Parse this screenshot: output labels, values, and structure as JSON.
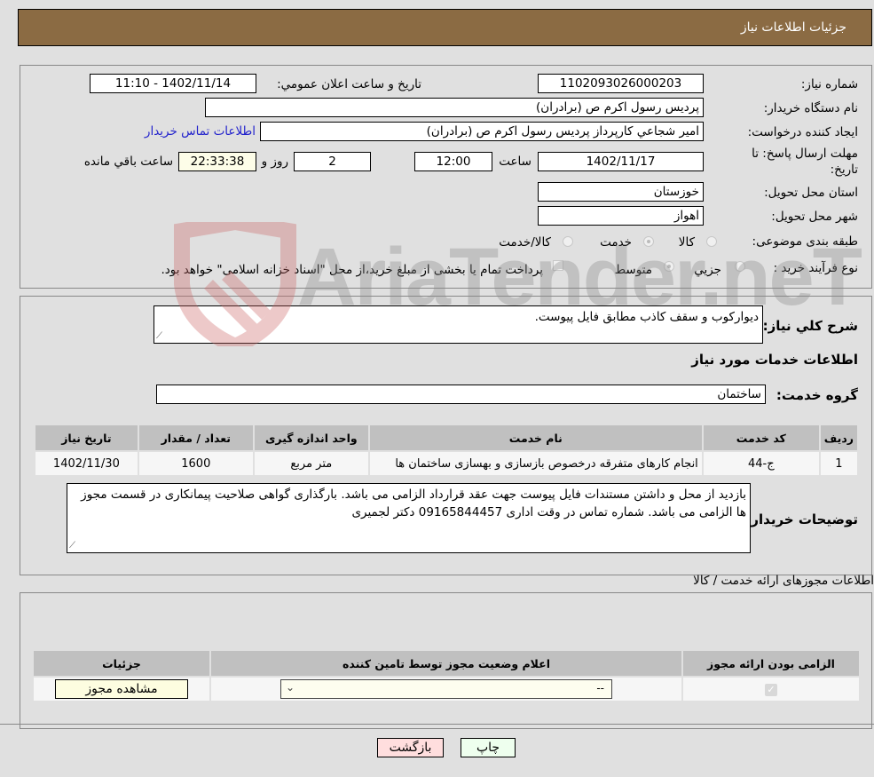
{
  "header": {
    "title": "جزئيات اطلاعات نياز"
  },
  "form": {
    "need_number": {
      "label": "شماره نياز:",
      "value": "1102093026000203"
    },
    "announce_datetime": {
      "label": "تاريخ و ساعت اعلان عمومي:",
      "value": "1402/11/14 - 11:10"
    },
    "buyer_org": {
      "label": "نام دستگاه خريدار:",
      "value": "پرديس رسول اكرم ص (برادران)"
    },
    "requester": {
      "label": "ايجاد كننده درخواست:",
      "value": "امير  شجاعي كارپرداز پرديس رسول اكرم ص (برادران)"
    },
    "buyer_contact_link": "اطلاعات تماس خريدار",
    "deadline": {
      "label_line1": "مهلت ارسال پاسخ: تا",
      "label_line2": "تاريخ:",
      "date": "1402/11/17",
      "time_label": "ساعت",
      "time": "12:00",
      "days": "2",
      "days_label": "روز و",
      "remaining": "22:33:38",
      "remaining_label": "ساعت باقي مانده"
    },
    "province": {
      "label": "استان محل تحويل:",
      "value": "خوزستان"
    },
    "city": {
      "label": "شهر محل تحويل:",
      "value": "اهواز"
    },
    "category": {
      "label": "طبقه بندی موضوعی:",
      "options": [
        "كالا",
        "خدمت",
        "كالا/خدمت"
      ],
      "selected": "خدمت"
    },
    "process_type": {
      "label": "نوع فرآيند خريد :",
      "options": [
        "جزيي",
        "متوسط"
      ],
      "selected": "متوسط",
      "treasury_note": "پرداخت تمام يا بخشی از مبلغ خريد،از محل \"اسناد خزانه اسلامی\" خواهد بود."
    }
  },
  "description": {
    "label": "شرح كلي نياز:",
    "value": "ديواركوب و سقف كاذب مطابق فايل پيوست."
  },
  "services": {
    "section_title": "اطلاعات خدمات مورد نياز",
    "group_label": "گروه خدمت:",
    "group_value": "ساختمان",
    "table": {
      "headers": [
        "رديف",
        "كد خدمت",
        "نام خدمت",
        "واحد اندازه گيری",
        "تعداد / مقدار",
        "تاريخ نياز"
      ],
      "rows": [
        [
          "1",
          "ج-44",
          "انجام كارهای متفرقه درخصوص بازسازی و بهسازی ساختمان ها",
          "متر مربع",
          "1600",
          "1402/11/30"
        ]
      ]
    }
  },
  "buyer_notes": {
    "label": "توضيحات خريدار:",
    "value": "بازديد از محل و داشتن مستندات فايل پيوست جهت عقد قرارداد الزامی می باشد. بارگذاری گواهی صلاحيت پيمانكاری در قسمت مجوز ها الزامی می باشد. شماره تماس در وقت اداری 09165844457 دكتر لجميری"
  },
  "permits": {
    "section_title": "اطلاعات مجوزهای ارائه خدمت / كالا",
    "table": {
      "headers": [
        "الزامی بودن ارائه مجوز",
        "اعلام وضعيت مجوز توسط تامين كننده",
        "جزئيات"
      ],
      "rows": [
        {
          "required_checked": true,
          "status_value": "--",
          "details_button": "مشاهده مجوز"
        }
      ]
    }
  },
  "actions": {
    "print": "چاپ",
    "back": "بازگشت"
  },
  "watermark": {
    "text": "AriaTender.neT"
  },
  "colors": {
    "header_bg": "#8b6b43",
    "back_btn_bg": "#ffdede",
    "print_btn_bg": "#eeffee",
    "link": "#2222cc"
  }
}
